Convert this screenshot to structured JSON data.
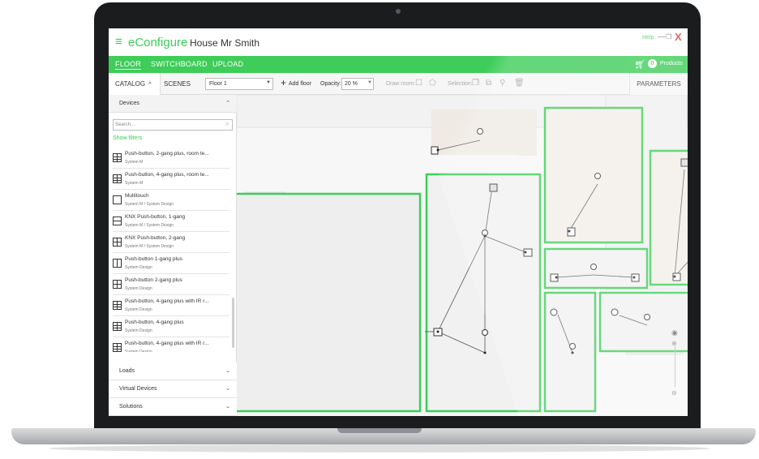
{
  "app": {
    "name": "eConfigure",
    "project": "House Mr Smith",
    "help": "Help",
    "minimize_glyph": "—",
    "maximize_glyph": "❐",
    "close_glyph": "X"
  },
  "nav": {
    "tabs": [
      "FLOOR",
      "SWITCHBOARD",
      "UPLOAD"
    ],
    "active": "FLOOR",
    "cart_count": "0",
    "products": "Products"
  },
  "toolbar": {
    "catalog": "CATALOG",
    "catalog_arrow": "^",
    "scenes": "SCENES",
    "floor": "Floor 1",
    "add_floor": "Add floor",
    "opacity_label": "Opacity:",
    "opacity_value": "20 %",
    "draw_room": "Draw room:",
    "selection": "Selection:",
    "parameters": "PARAMETERS"
  },
  "sidebar": {
    "devices_header": "Devices",
    "search_placeholder": "Search...",
    "show_filters": "Show filters",
    "devices": [
      {
        "name": "Push-button, 2-gang plus, room te...",
        "sub": "System M",
        "icon": "g4"
      },
      {
        "name": "Push-button, 4-gang plus, room te...",
        "sub": "System M",
        "icon": "g4"
      },
      {
        "name": "Multitouch",
        "sub": "System M / System Design",
        "icon": "plain"
      },
      {
        "name": "KNX Push-button, 1-gang",
        "sub": "System M / System Design",
        "icon": "h"
      },
      {
        "name": "KNX Push-button, 2-gang",
        "sub": "System M / System Design",
        "icon": "hv"
      },
      {
        "name": "Push-button 1-gang plus",
        "sub": "System Design",
        "icon": "v"
      },
      {
        "name": "Push-button 2-gang plus",
        "sub": "System Design",
        "icon": "hv"
      },
      {
        "name": "Push-button, 4-gang plus with IR r...",
        "sub": "System Design",
        "icon": "g4"
      },
      {
        "name": "Push-button, 4-gang plus",
        "sub": "System Design",
        "icon": "g4"
      },
      {
        "name": "Push-button, 4-gang plus with IR r...",
        "sub": "System Design",
        "icon": "g4"
      }
    ],
    "sections": [
      "Loads",
      "Virtual Devices",
      "Solutions"
    ]
  },
  "colors": {
    "accent": "#3dcd58",
    "close": "#e53935",
    "room_fill": "#f0f0f0"
  },
  "icons": [
    "menu-icon",
    "cart-icon",
    "search-icon",
    "chevron-down-icon",
    "chevron-up-icon",
    "eye-icon",
    "zoom-in-icon",
    "zoom-out-icon",
    "plus-icon",
    "bulb-icon",
    "switch-icon",
    "thermostat-icon"
  ]
}
